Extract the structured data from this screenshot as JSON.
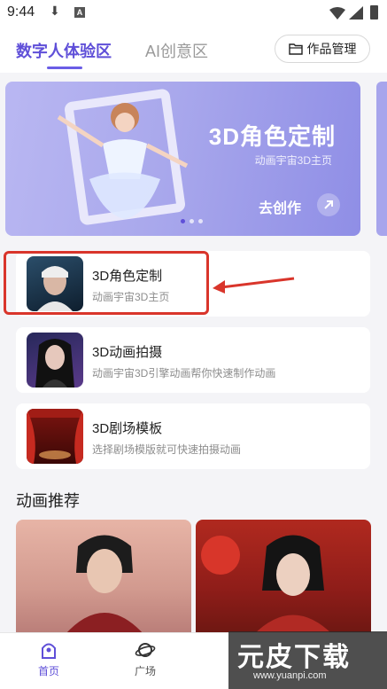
{
  "status_bar": {
    "time": "9:44",
    "badge": "A"
  },
  "tabs": [
    {
      "label": "数字人体验区",
      "active": true
    },
    {
      "label": "AI创意区",
      "active": false
    }
  ],
  "manage_button": {
    "label": "作品管理",
    "icon": "folder-icon"
  },
  "banner": {
    "title": "3D角色定制",
    "subtitle": "动画宇宙3D主页",
    "cta": "去创作",
    "page_count": 3,
    "active_page": 1
  },
  "features": [
    {
      "title": "3D角色定制",
      "subtitle": "动画宇宙3D主页"
    },
    {
      "title": "3D动画拍摄",
      "subtitle": "动画宇宙3D引擎动画帮你快速制作动画"
    },
    {
      "title": "3D剧场模板",
      "subtitle": "选择剧场模版就可快速拍摄动画"
    }
  ],
  "recommend_section": {
    "title": "动画推荐"
  },
  "bottom_nav": [
    {
      "label": "首页",
      "icon": "home-icon",
      "active": true
    },
    {
      "label": "广场",
      "icon": "planet-icon",
      "active": false
    }
  ],
  "watermark": {
    "text": "元皮下载",
    "url": "www.yuanpi.com"
  },
  "colors": {
    "accent": "#5f4fd8",
    "highlight": "#d9352b"
  }
}
